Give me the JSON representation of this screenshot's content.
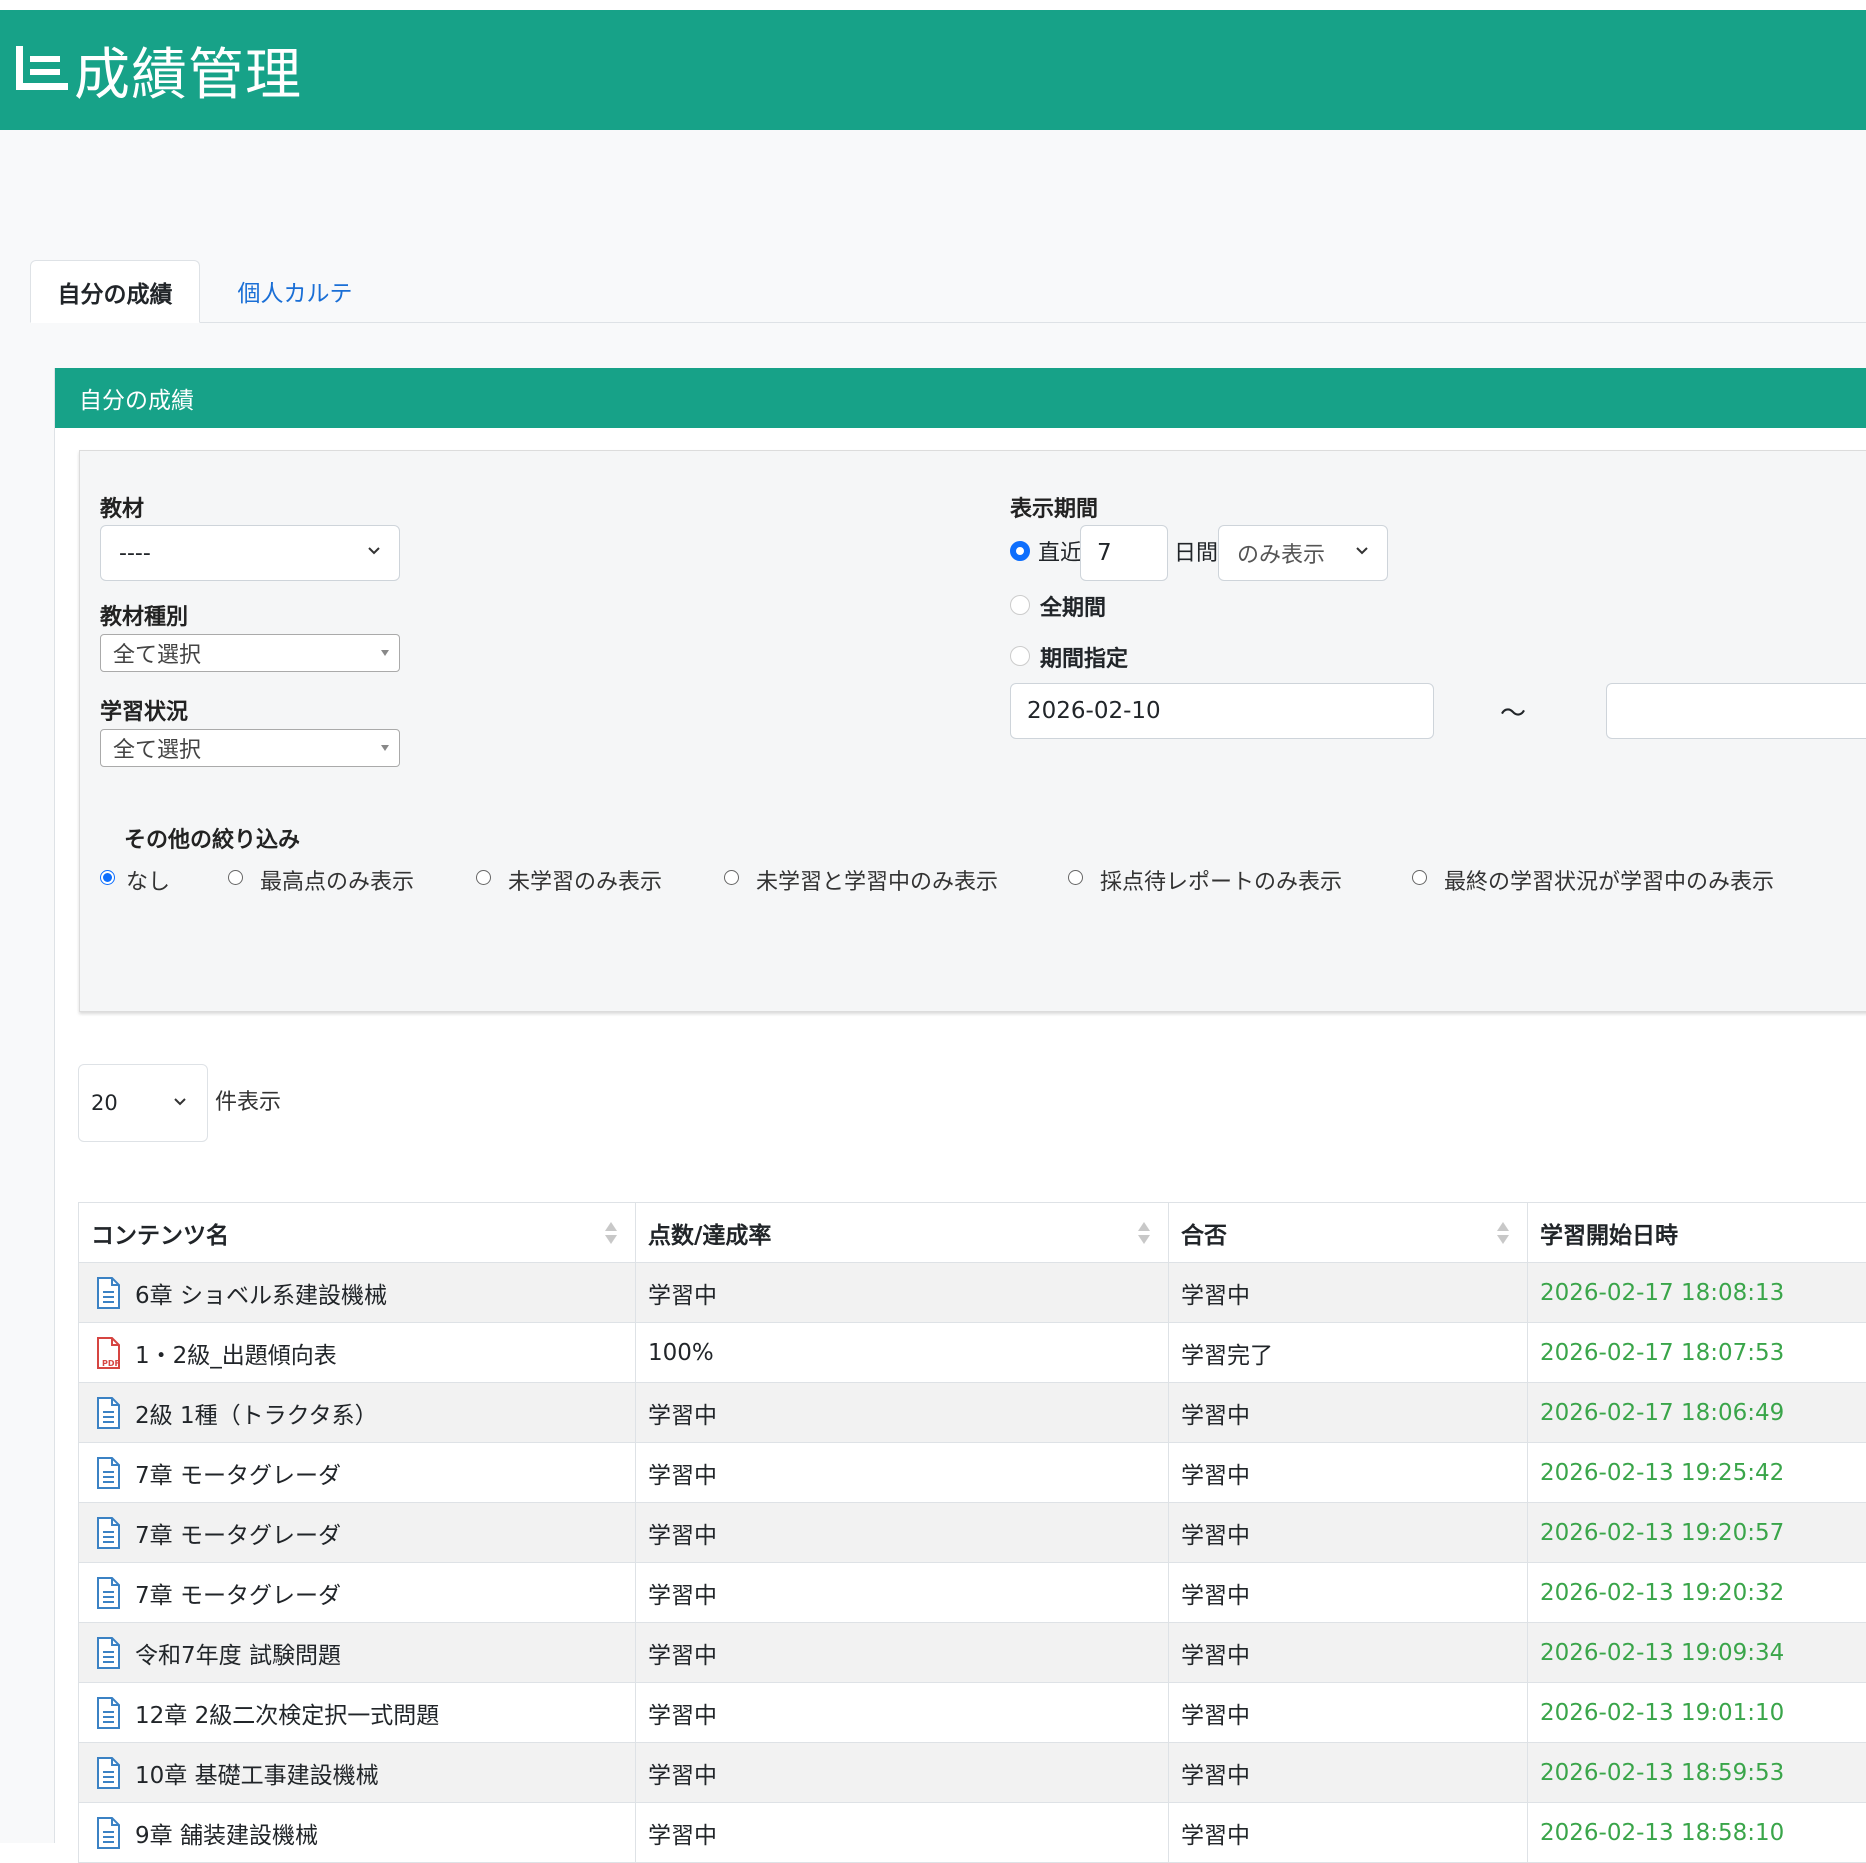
{
  "header": {
    "title": "成績管理",
    "icon": "list-icon",
    "color": "#17a288"
  },
  "tabs": [
    {
      "label": "自分の成績",
      "active": true
    },
    {
      "label": "個人カルテ",
      "active": false
    }
  ],
  "card": {
    "title": "自分の成績",
    "filters": {
      "material": {
        "label": "教材",
        "value": "----"
      },
      "material_type": {
        "label": "教材種別",
        "value": "全て選択"
      },
      "study_status": {
        "label": "学習状況",
        "value": "全て選択"
      },
      "period": {
        "label": "表示期間",
        "recent_label": "直近",
        "recent_days": "7",
        "days_label": "日間",
        "mode_select": "のみ表示",
        "all_label": "全期間",
        "range_label": "期間指定",
        "start_date": "2026-02-10",
        "tilde": "～",
        "end_date": "",
        "selected": "recent"
      },
      "other": {
        "label": "その他の絞り込み",
        "options": [
          "なし",
          "最高点のみ表示",
          "未学習のみ表示",
          "未学習と学習中のみ表示",
          "採点待レポートのみ表示",
          "最終の学習状況が学習中のみ表示"
        ],
        "selected": "なし"
      }
    },
    "per_page": {
      "value": "20",
      "label": "件表示"
    },
    "table": {
      "columns": [
        "コンテンツ名",
        "点数/達成率",
        "合否",
        "学習開始日時"
      ],
      "rows": [
        {
          "icon": "document-icon",
          "name": "6章 ショベル系建設機械",
          "score": "学習中",
          "result": "学習中",
          "start": "2026-02-17 18:08:13"
        },
        {
          "icon": "pdf-icon",
          "name": "1・2級_出題傾向表",
          "score": "100%",
          "result": "学習完了",
          "start": "2026-02-17 18:07:53"
        },
        {
          "icon": "document-icon",
          "name": "2級 1種（トラクタ系）",
          "score": "学習中",
          "result": "学習中",
          "start": "2026-02-17 18:06:49"
        },
        {
          "icon": "document-icon",
          "name": "7章 モータグレーダ",
          "score": "学習中",
          "result": "学習中",
          "start": "2026-02-13 19:25:42"
        },
        {
          "icon": "document-icon",
          "name": "7章 モータグレーダ",
          "score": "学習中",
          "result": "学習中",
          "start": "2026-02-13 19:20:57"
        },
        {
          "icon": "document-icon",
          "name": "7章 モータグレーダ",
          "score": "学習中",
          "result": "学習中",
          "start": "2026-02-13 19:20:32"
        },
        {
          "icon": "document-icon",
          "name": "令和7年度 試験問題",
          "score": "学習中",
          "result": "学習中",
          "start": "2026-02-13 19:09:34"
        },
        {
          "icon": "document-icon",
          "name": "12章 2級二次検定択一式問題",
          "score": "学習中",
          "result": "学習中",
          "start": "2026-02-13 19:01:10"
        },
        {
          "icon": "document-icon",
          "name": "10章 基礎工事建設機械",
          "score": "学習中",
          "result": "学習中",
          "start": "2026-02-13 18:59:53"
        },
        {
          "icon": "document-icon",
          "name": "9章 舗装建設機械",
          "score": "学習中",
          "result": "学習中",
          "start": "2026-02-13 18:58:10"
        }
      ]
    }
  },
  "colors": {
    "accent": "#17a288",
    "link": "#1a6fd6",
    "date": "#3aa54a",
    "radio": "#0d6efd",
    "pdf": "#d64541",
    "doc": "#3b82c4"
  }
}
